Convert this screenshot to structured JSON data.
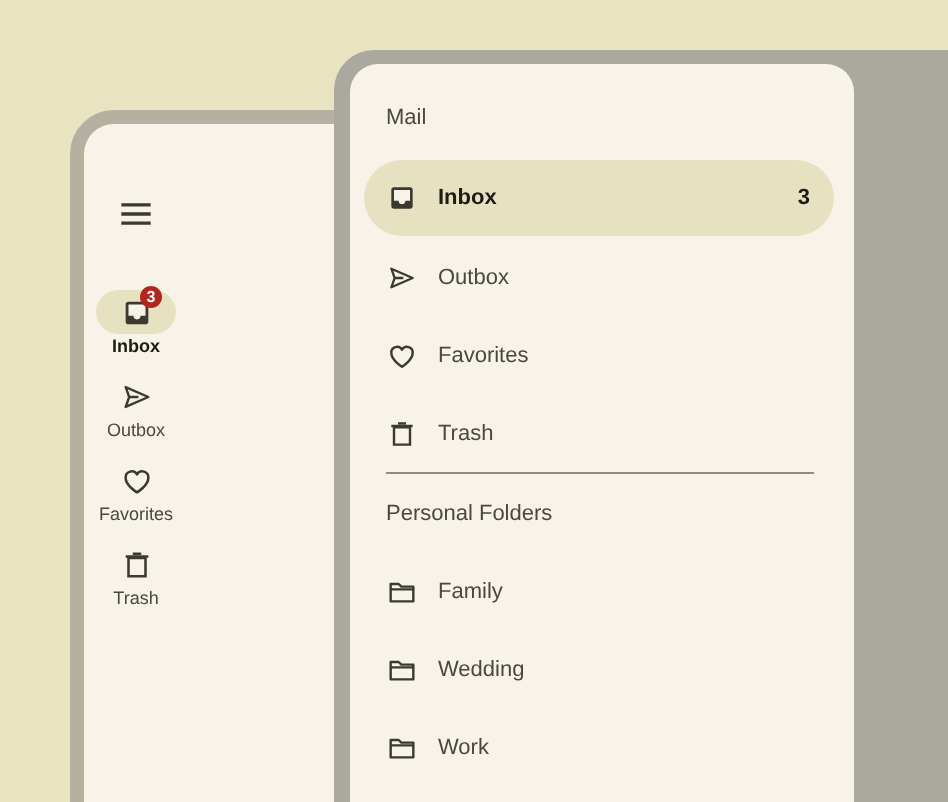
{
  "rail": {
    "items": [
      {
        "label": "Inbox",
        "selected": true,
        "badge": "3"
      },
      {
        "label": "Outbox",
        "selected": false
      },
      {
        "label": "Favorites",
        "selected": false
      },
      {
        "label": "Trash",
        "selected": false
      }
    ]
  },
  "drawer": {
    "sections": [
      {
        "kind": "mail",
        "title": "Mail",
        "items": [
          {
            "label": "Inbox",
            "selected": true,
            "badge": "3"
          },
          {
            "label": "Outbox",
            "selected": false
          },
          {
            "label": "Favorites",
            "selected": false
          },
          {
            "label": "Trash",
            "selected": false
          }
        ]
      },
      {
        "kind": "folders",
        "title": "Personal Folders",
        "items": [
          {
            "label": "Family",
            "selected": false
          },
          {
            "label": "Wedding",
            "selected": false
          },
          {
            "label": "Work",
            "selected": false
          }
        ]
      }
    ]
  }
}
